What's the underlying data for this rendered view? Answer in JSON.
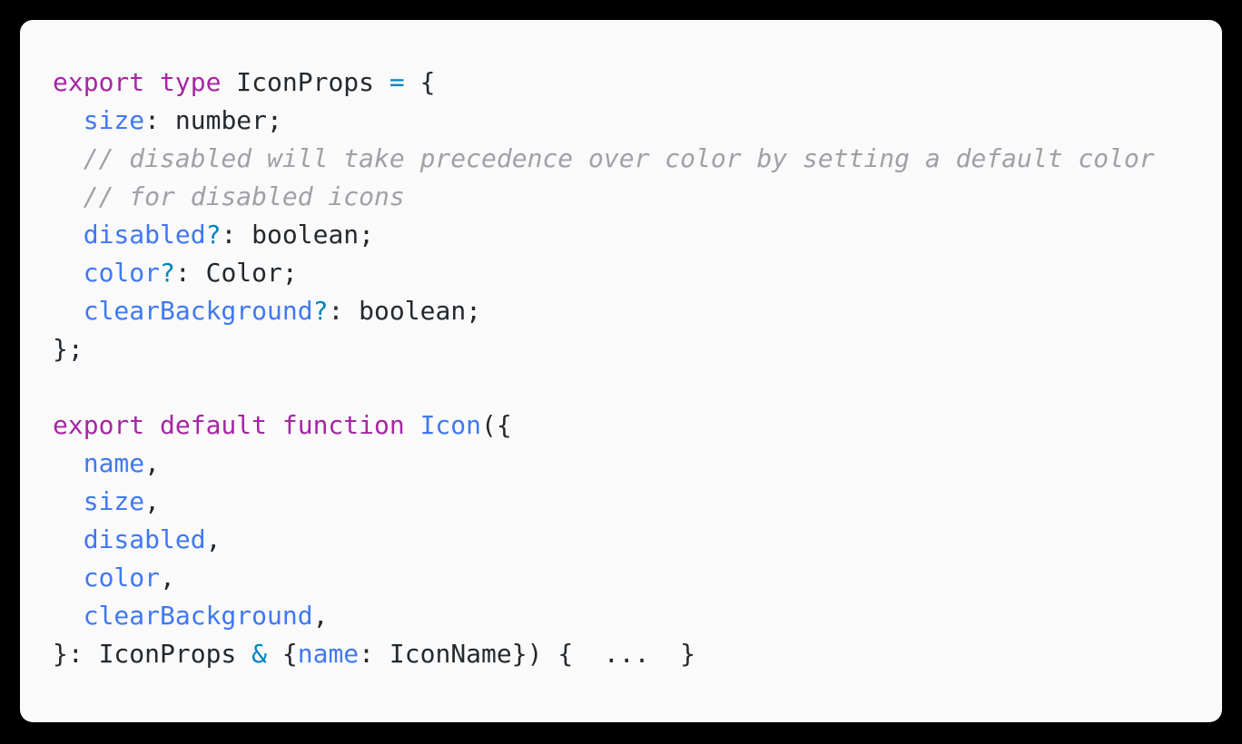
{
  "window": {
    "background_color": "#000000",
    "card_background": "#FAFAFA",
    "card_radius_px": 14
  },
  "theme": {
    "name": "one-light",
    "keyword_color": "#A626A4",
    "identifier_color": "#4078F2",
    "operator_color": "#0184BC",
    "plain_color": "#24292E",
    "comment_color": "#A0A1A7"
  },
  "code": {
    "language": "typescript",
    "font_size_px": 28,
    "line_height_px": 42,
    "plain_text": "export type IconProps = {\n  size: number;\n  // disabled will take precedence over color by setting a default color\n  // for disabled icons\n  disabled?: boolean;\n  color?: Color;\n  clearBackground?: boolean;\n};\n\nexport default function Icon({\n  name,\n  size,\n  disabled,\n  color,\n  clearBackground,\n}: IconProps & {name: IconName}) {  ...  }",
    "lines": [
      {
        "index": 1,
        "tokens": [
          {
            "text": "export type ",
            "kind": "keyword"
          },
          {
            "text": "IconProps",
            "kind": "type"
          },
          {
            "text": " ",
            "kind": "plain"
          },
          {
            "text": "=",
            "kind": "operator"
          },
          {
            "text": " {",
            "kind": "punct"
          }
        ]
      },
      {
        "index": 2,
        "tokens": [
          {
            "text": "  ",
            "kind": "plain"
          },
          {
            "text": "size",
            "kind": "ident"
          },
          {
            "text": ": number;",
            "kind": "plain"
          }
        ]
      },
      {
        "index": 3,
        "tokens": [
          {
            "text": "  // disabled will take precedence over color by setting a default color",
            "kind": "comment"
          }
        ]
      },
      {
        "index": 4,
        "tokens": [
          {
            "text": "  // for disabled icons",
            "kind": "comment"
          }
        ]
      },
      {
        "index": 5,
        "tokens": [
          {
            "text": "  ",
            "kind": "plain"
          },
          {
            "text": "disabled",
            "kind": "ident"
          },
          {
            "text": "?",
            "kind": "operator"
          },
          {
            "text": ": boolean;",
            "kind": "plain"
          }
        ]
      },
      {
        "index": 6,
        "tokens": [
          {
            "text": "  ",
            "kind": "plain"
          },
          {
            "text": "color",
            "kind": "ident"
          },
          {
            "text": "?",
            "kind": "operator"
          },
          {
            "text": ": Color;",
            "kind": "plain"
          }
        ]
      },
      {
        "index": 7,
        "tokens": [
          {
            "text": "  ",
            "kind": "plain"
          },
          {
            "text": "clearBackground",
            "kind": "ident"
          },
          {
            "text": "?",
            "kind": "operator"
          },
          {
            "text": ": boolean;",
            "kind": "plain"
          }
        ]
      },
      {
        "index": 8,
        "tokens": [
          {
            "text": "};",
            "kind": "punct"
          }
        ]
      },
      {
        "index": 9,
        "tokens": []
      },
      {
        "index": 10,
        "tokens": [
          {
            "text": "export default function ",
            "kind": "keyword"
          },
          {
            "text": "Icon",
            "kind": "ident"
          },
          {
            "text": "({",
            "kind": "punct"
          }
        ]
      },
      {
        "index": 11,
        "tokens": [
          {
            "text": "  ",
            "kind": "plain"
          },
          {
            "text": "name",
            "kind": "ident"
          },
          {
            "text": ",",
            "kind": "punct"
          }
        ]
      },
      {
        "index": 12,
        "tokens": [
          {
            "text": "  ",
            "kind": "plain"
          },
          {
            "text": "size",
            "kind": "ident"
          },
          {
            "text": ",",
            "kind": "punct"
          }
        ]
      },
      {
        "index": 13,
        "tokens": [
          {
            "text": "  ",
            "kind": "plain"
          },
          {
            "text": "disabled",
            "kind": "ident"
          },
          {
            "text": ",",
            "kind": "punct"
          }
        ]
      },
      {
        "index": 14,
        "tokens": [
          {
            "text": "  ",
            "kind": "plain"
          },
          {
            "text": "color",
            "kind": "ident"
          },
          {
            "text": ",",
            "kind": "punct"
          }
        ]
      },
      {
        "index": 15,
        "tokens": [
          {
            "text": "  ",
            "kind": "plain"
          },
          {
            "text": "clearBackground",
            "kind": "ident"
          },
          {
            "text": ",",
            "kind": "punct"
          }
        ]
      },
      {
        "index": 16,
        "tokens": [
          {
            "text": "}: IconProps ",
            "kind": "plain"
          },
          {
            "text": "&",
            "kind": "operator"
          },
          {
            "text": " {",
            "kind": "punct"
          },
          {
            "text": "name",
            "kind": "ident"
          },
          {
            "text": ": IconName}) {  ...  }",
            "kind": "plain"
          }
        ]
      }
    ]
  }
}
